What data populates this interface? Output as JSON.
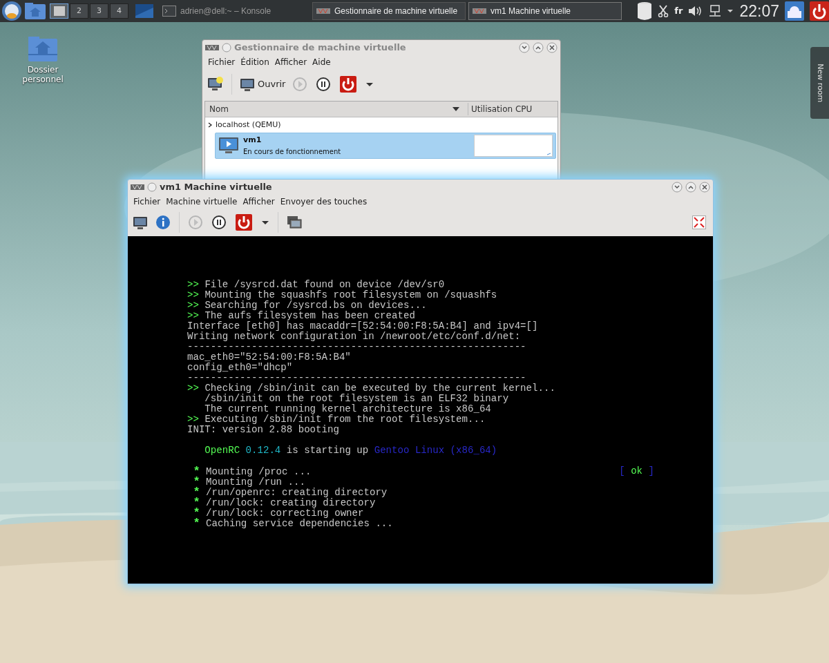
{
  "taskbar": {
    "pager": [
      {
        "selected": true
      },
      {
        "label": "2",
        "selected": false
      },
      {
        "label": "3",
        "selected": false
      },
      {
        "label": "4",
        "selected": false
      }
    ],
    "tasks": [
      {
        "title": "adrien@dell:~ – Konsole",
        "kind": "terminal",
        "selected": false
      },
      {
        "title": "Gestionnaire de machine virtuelle",
        "kind": "vmm",
        "selected": false
      },
      {
        "title": "vm1 Machine virtuelle",
        "kind": "vmm",
        "selected": true
      }
    ],
    "keyboard_layout": "fr",
    "clock": "22:07"
  },
  "desktop_icons": [
    {
      "label": "Dossier personnel"
    }
  ],
  "side_tab": {
    "label": "New room"
  },
  "manager_window": {
    "title": "Gestionnaire de machine virtuelle",
    "menu": [
      "Fichier",
      "Édition",
      "Afficher",
      "Aide"
    ],
    "toolbar": {
      "open_label": "Ouvrir",
      "run_disabled": true
    },
    "columns": [
      "Nom",
      "Utilisation CPU"
    ],
    "hosts": [
      {
        "name": "localhost (QEMU)",
        "children": [
          {
            "name": "vm1",
            "status": "En cours de fonctionnement",
            "selected": true
          }
        ]
      }
    ]
  },
  "vm_window": {
    "title": "vm1 Machine virtuelle",
    "menu": [
      "Fichier",
      "Machine virtuelle",
      "Afficher",
      "Envoyer des touches"
    ],
    "toolbar": {
      "run_disabled": true
    },
    "console": [
      {
        "kind": "plain",
        "segments": [
          {
            "text": ">>",
            "color": "#54fc54"
          },
          {
            "text": " File /sysrcd.dat found on device /dev/sr0",
            "color": "#c8c8c8"
          }
        ]
      },
      {
        "kind": "plain",
        "segments": [
          {
            "text": ">>",
            "color": "#54fc54"
          },
          {
            "text": " Mounting the squashfs root filesystem on /squashfs",
            "color": "#c8c8c8"
          }
        ]
      },
      {
        "kind": "plain",
        "segments": [
          {
            "text": ">>",
            "color": "#54fc54"
          },
          {
            "text": " Searching for /sysrcd.bs on devices...",
            "color": "#c8c8c8"
          }
        ]
      },
      {
        "kind": "plain",
        "segments": [
          {
            "text": ">>",
            "color": "#54fc54"
          },
          {
            "text": " The aufs filesystem has been created",
            "color": "#c8c8c8"
          }
        ]
      },
      {
        "kind": "plain",
        "segments": [
          {
            "text": "Interface [eth0] has macaddr=[52:54:00:F8:5A:B4] and ipv4=[]",
            "color": "#c8c8c8"
          }
        ]
      },
      {
        "kind": "plain",
        "segments": [
          {
            "text": "Writing network configuration in /newroot/etc/conf.d/net:",
            "color": "#c8c8c8"
          }
        ]
      },
      {
        "kind": "plain",
        "segments": [
          {
            "text": "----------------------------------------------------------",
            "color": "#c8c8c8"
          }
        ]
      },
      {
        "kind": "plain",
        "segments": [
          {
            "text": "mac_eth0=\"52:54:00:F8:5A:B4\"",
            "color": "#c8c8c8"
          }
        ]
      },
      {
        "kind": "plain",
        "segments": [
          {
            "text": "config_eth0=\"dhcp\"",
            "color": "#c8c8c8"
          }
        ]
      },
      {
        "kind": "plain",
        "segments": [
          {
            "text": "----------------------------------------------------------",
            "color": "#c8c8c8"
          }
        ]
      },
      {
        "kind": "plain",
        "segments": [
          {
            "text": ">>",
            "color": "#54fc54"
          },
          {
            "text": " Checking /sbin/init can be executed by the current kernel...",
            "color": "#c8c8c8"
          }
        ]
      },
      {
        "kind": "plain",
        "segments": [
          {
            "text": "   /sbin/init on the root filesystem is an ELF32 binary",
            "color": "#c8c8c8"
          }
        ]
      },
      {
        "kind": "plain",
        "segments": [
          {
            "text": "   The current running kernel architecture is x86_64",
            "color": "#c8c8c8"
          }
        ]
      },
      {
        "kind": "plain",
        "segments": [
          {
            "text": ">>",
            "color": "#54fc54"
          },
          {
            "text": " Executing /sbin/init from the root filesystem...",
            "color": "#c8c8c8"
          }
        ]
      },
      {
        "kind": "plain",
        "segments": [
          {
            "text": "INIT: version 2.88 booting",
            "color": "#c8c8c8"
          }
        ]
      },
      {
        "kind": "plain",
        "gap_before": true,
        "segments": [
          {
            "text": "   OpenRC",
            "color": "#54fc54"
          },
          {
            "text": " 0.12.4",
            "color": "#20b8c8"
          },
          {
            "text": " is starting up ",
            "color": "#c8c8c8"
          },
          {
            "text": "Gentoo Linux (x86_64)",
            "color": "#2828c8"
          }
        ]
      },
      {
        "kind": "bullet",
        "gap_before": true,
        "segments": [
          {
            "text": "*",
            "color": "#54fc54"
          },
          {
            "text": " Mounting /proc ...",
            "color": "#c8c8c8"
          }
        ],
        "status": [
          {
            "text": "[",
            "color": "#2828c8"
          },
          {
            "text": " ok ",
            "color": "#54fc54"
          },
          {
            "text": "]",
            "color": "#2828c8"
          }
        ]
      },
      {
        "kind": "bullet",
        "segments": [
          {
            "text": "*",
            "color": "#54fc54"
          },
          {
            "text": " Mounting /run ...",
            "color": "#c8c8c8"
          }
        ]
      },
      {
        "kind": "bullet",
        "segments": [
          {
            "text": "*",
            "color": "#54fc54"
          },
          {
            "text": " /run/openrc: creating directory",
            "color": "#c8c8c8"
          }
        ]
      },
      {
        "kind": "bullet",
        "segments": [
          {
            "text": "*",
            "color": "#54fc54"
          },
          {
            "text": " /run/lock: creating directory",
            "color": "#c8c8c8"
          }
        ]
      },
      {
        "kind": "bullet",
        "segments": [
          {
            "text": "*",
            "color": "#54fc54"
          },
          {
            "text": " /run/lock: correcting owner",
            "color": "#c8c8c8"
          }
        ]
      },
      {
        "kind": "bullet",
        "segments": [
          {
            "text": "*",
            "color": "#54fc54"
          },
          {
            "text": " Caching service dependencies ...",
            "color": "#c8c8c8"
          }
        ]
      }
    ]
  }
}
